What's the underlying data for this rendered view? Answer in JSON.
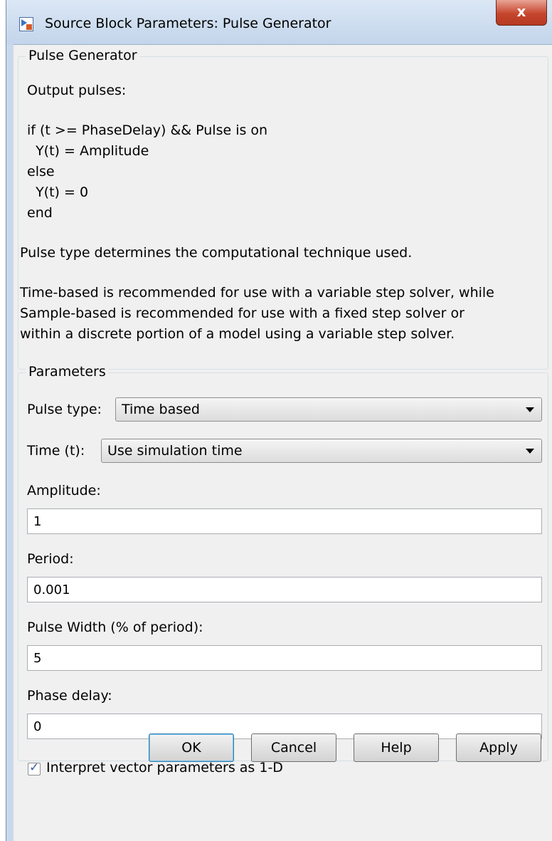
{
  "window": {
    "title": "Source Block Parameters: Pulse Generator",
    "close_glyph": "x"
  },
  "description": {
    "heading": "Pulse Generator",
    "intro": "Output pulses:",
    "code_lines": [
      "if (t >= PhaseDelay) && Pulse is on",
      "  Y(t) = Amplitude",
      "else",
      "  Y(t) = 0",
      "end"
    ],
    "pulse_type_note": "Pulse type determines the computational technique used.",
    "recommend_lines": [
      "Time-based is recommended for use with a variable step solver, while",
      "Sample-based is recommended for use with a fixed step solver or",
      "within a discrete portion of a model using a variable step solver."
    ]
  },
  "parameters": {
    "heading": "Parameters",
    "pulse_type": {
      "label": "Pulse type:",
      "value": "Time based"
    },
    "time": {
      "label": "Time (t):",
      "value": "Use simulation time"
    },
    "amplitude": {
      "label": "Amplitude:",
      "value": "1"
    },
    "period": {
      "label": "Period:",
      "value": "0.001"
    },
    "pulse_width": {
      "label": "Pulse Width (% of period):",
      "value": "5"
    },
    "phase_delay": {
      "label": "Phase delay:",
      "value": "0"
    },
    "interpret_vector": {
      "label": "Interpret vector parameters as 1-D",
      "checked": true
    }
  },
  "buttons": {
    "ok": "OK",
    "cancel": "Cancel",
    "help": "Help",
    "apply": "Apply"
  },
  "icons": {
    "app": "simulink-block-icon",
    "close": "close-icon",
    "dropdown": "chevron-down-icon",
    "check": "checkmark-icon"
  }
}
